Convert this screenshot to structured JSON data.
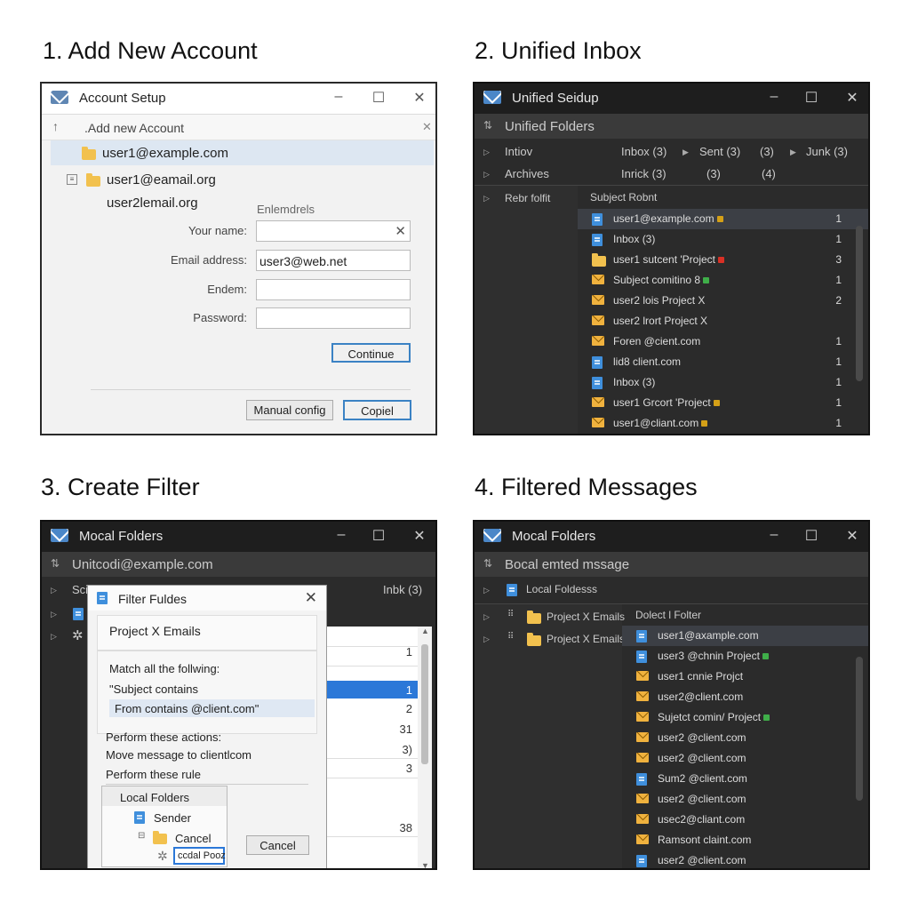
{
  "panels": [
    {
      "title": "1. Add New Account"
    },
    {
      "title": "2. Unified Inbox"
    },
    {
      "title": "3. Create Filter"
    },
    {
      "title": "4. Filtered Messages"
    }
  ],
  "p1": {
    "window_title": "Account Setup",
    "toolbar_text": ".Add  new  Account",
    "account_selected": "user1@example.com",
    "account_2": "user1@eamail.org",
    "account_3": "user2lemail.org",
    "field_hint": "Enlemdrels",
    "labels": {
      "name": "Your name:",
      "email": "Email address:",
      "endem": "Endem:",
      "password": "Password:"
    },
    "values": {
      "email": "user3@web.net"
    },
    "continue_label": "Continue",
    "manual_config_label": "Manual config",
    "cancel_label": "Copiel",
    "colors": {
      "accent": "#3b82c4"
    }
  },
  "p2": {
    "window_title": "Unified Seidup",
    "header": "Unified  Folders",
    "tree": [
      {
        "label": "Intiov",
        "c1": "Inbox (3)",
        "c2": "Sent (3)",
        "c3": "(3)",
        "c4": "Junk (3)"
      },
      {
        "label": "Archives",
        "c1": "Inrick (3)",
        "c2": "(3)",
        "c3": "(4)"
      }
    ],
    "side_label": "Rebr folfit",
    "column_header": "Subject Robnt",
    "messages": [
      {
        "icon": "doc-icon",
        "text": "user1@example.com",
        "count": "1",
        "tag": "#d4a017"
      },
      {
        "icon": "doc-icon",
        "text": "Inbox (3)",
        "count": "1"
      },
      {
        "icon": "folder-icon",
        "text": "user1 sutcent 'Project",
        "count": "3",
        "tag": "#d93025"
      },
      {
        "icon": "mail-icon",
        "text": "Subject comitino 8",
        "count": "1",
        "tag": "#3fae49"
      },
      {
        "icon": "mail-icon",
        "text": "user2 lois Project X",
        "count": "2"
      },
      {
        "icon": "mail-icon",
        "text": "user2 lrort Project X",
        "count": ""
      },
      {
        "icon": "mail-icon",
        "text": "Foren @cient.com",
        "count": "1"
      },
      {
        "icon": "doc-icon",
        "text": "lid8 client.com",
        "count": "1"
      },
      {
        "icon": "doc-icon",
        "text": "Inbox (3)",
        "count": "1"
      },
      {
        "icon": "mail-icon",
        "text": "user1 Grcort 'Project",
        "count": "1",
        "tag": "#d4a017"
      },
      {
        "icon": "mail-icon",
        "text": "user1@cliant.com",
        "count": "1",
        "tag": "#d4a017"
      }
    ]
  },
  "p3": {
    "window_title": "Mocal Folders",
    "account_row": "Unitcodi@example.com",
    "row_side": "Sci",
    "inbox_label": "Inbk (3)",
    "dialog_title": "Filter Fuldes",
    "filter_name": "Project X Emails",
    "match_label": "Match all the follwing:",
    "condition_1": "\"Subject contains",
    "condition_2": "From contains @client.com\"",
    "actions_label": "Perform these actions:",
    "action_1": "Move message to clientlcom",
    "rule_label": "Perform these rule",
    "dropdown": {
      "header": "Local Folders",
      "item_1": "Sender",
      "item_2": "Cancel",
      "item_3": "ccdal Pooz"
    },
    "cancel_label": "Cancel",
    "list_counts": [
      "1",
      "1",
      "2",
      "31",
      "3)",
      "3",
      "38"
    ]
  },
  "p4": {
    "window_title": "Mocal Folders",
    "subheader": "Bocal  emted  mssage",
    "local_folders": "Local Foldesss",
    "tree": [
      "Project X Emails",
      "Project X Emails"
    ],
    "column_header": "Dolect l Folter",
    "messages": [
      {
        "icon": "doc-icon",
        "text": "user1@axample.com"
      },
      {
        "icon": "doc-icon",
        "text": "user3 @chnin Project",
        "tag": "#3fae49"
      },
      {
        "icon": "mail-icon",
        "text": "user1 cnnie Projct"
      },
      {
        "icon": "mail-icon",
        "text": "user2@client.com"
      },
      {
        "icon": "mail-icon",
        "text": "Sujetct comin/ Project",
        "tag": "#3fae49"
      },
      {
        "icon": "mail-icon",
        "text": "user2 @client.com"
      },
      {
        "icon": "mail-icon",
        "text": "user2 @client.com"
      },
      {
        "icon": "doc-icon",
        "text": "Sum2 @client.com"
      },
      {
        "icon": "mail-icon",
        "text": "user2 @client.com"
      },
      {
        "icon": "mail-icon",
        "text": "usec2@cliant.com"
      },
      {
        "icon": "mail-icon",
        "text": "Ramsont claint.com"
      },
      {
        "icon": "doc-icon",
        "text": "user2 @client.com"
      }
    ]
  }
}
